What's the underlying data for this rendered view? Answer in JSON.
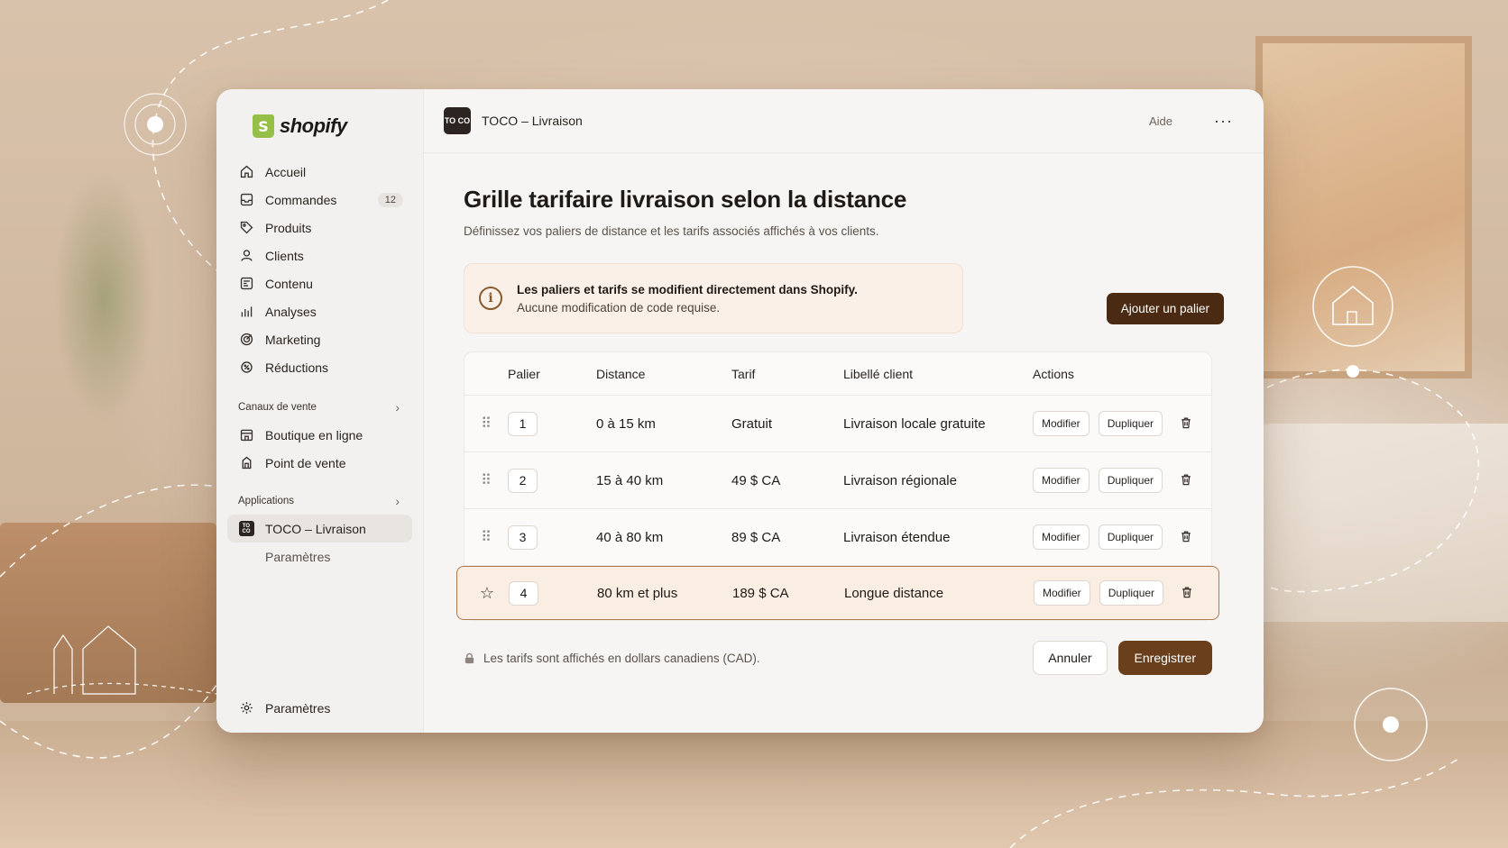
{
  "colors": {
    "accent": "#4a2a12",
    "save": "#6a3f1c",
    "highlight_bg": "#faeee3",
    "highlight_border": "#b07850",
    "brand_green": "#95bf47"
  },
  "sidebar": {
    "brand": "shopify",
    "brand_icon": "S",
    "items": [
      {
        "label": "Accueil",
        "icon": "home-icon"
      },
      {
        "label": "Commandes",
        "icon": "inbox-icon",
        "badge": "12"
      },
      {
        "label": "Produits",
        "icon": "tag-icon"
      },
      {
        "label": "Clients",
        "icon": "person-icon"
      },
      {
        "label": "Contenu",
        "icon": "content-icon"
      },
      {
        "label": "Analyses",
        "icon": "bar-chart-icon"
      },
      {
        "label": "Marketing",
        "icon": "target-icon"
      },
      {
        "label": "Réductions",
        "icon": "discount-icon"
      }
    ],
    "sales_channels": {
      "title": "Canaux de vente",
      "items": [
        {
          "label": "Boutique en ligne",
          "icon": "store-icon"
        },
        {
          "label": "Point de vente",
          "icon": "pos-icon"
        }
      ]
    },
    "apps": {
      "title": "Applications",
      "active_item": "TOCO – Livraison",
      "sub_item": "Paramètres"
    },
    "settings_label": "Paramètres"
  },
  "topbar": {
    "app_logo": "TO CO",
    "app_title": "TOCO – Livraison",
    "help": "Aide",
    "more": "···"
  },
  "page": {
    "title": "Grille tarifaire livraison selon la distance",
    "subtitle": "Définissez vos paliers de distance et les tarifs associés affichés à vos clients."
  },
  "banner": {
    "icon": "i",
    "title": "Les paliers et tarifs se modifient directement dans Shopify.",
    "subtitle": "Aucune modification de code requise."
  },
  "add_tier_button": "Ajouter un palier",
  "table": {
    "headers": {
      "palier": "Palier",
      "distance": "Distance",
      "tarif": "Tarif",
      "label": "Libellé client",
      "actions": "Actions"
    },
    "edit_label": "Modifier",
    "duplicate_label": "Dupliquer",
    "rows": [
      {
        "palier": "1",
        "distance": "0 à 15 km",
        "tarif": "Gratuit",
        "label": "Livraison locale gratuite",
        "handle": "⠿"
      },
      {
        "palier": "2",
        "distance": "15 à 40 km",
        "tarif": "49 $ CA",
        "label": "Livraison régionale",
        "handle": "⠿"
      },
      {
        "palier": "3",
        "distance": "40 à 80 km",
        "tarif": "89 $ CA",
        "label": "Livraison étendue",
        "handle": "⠿"
      },
      {
        "palier": "4",
        "distance": "80 km et plus",
        "tarif": "189 $ CA",
        "label": "Longue distance",
        "handle": "☆"
      }
    ]
  },
  "footer": {
    "note": "Les tarifs sont affichés en dollars canadiens (CAD).",
    "cancel": "Annuler",
    "save": "Enregistrer"
  }
}
